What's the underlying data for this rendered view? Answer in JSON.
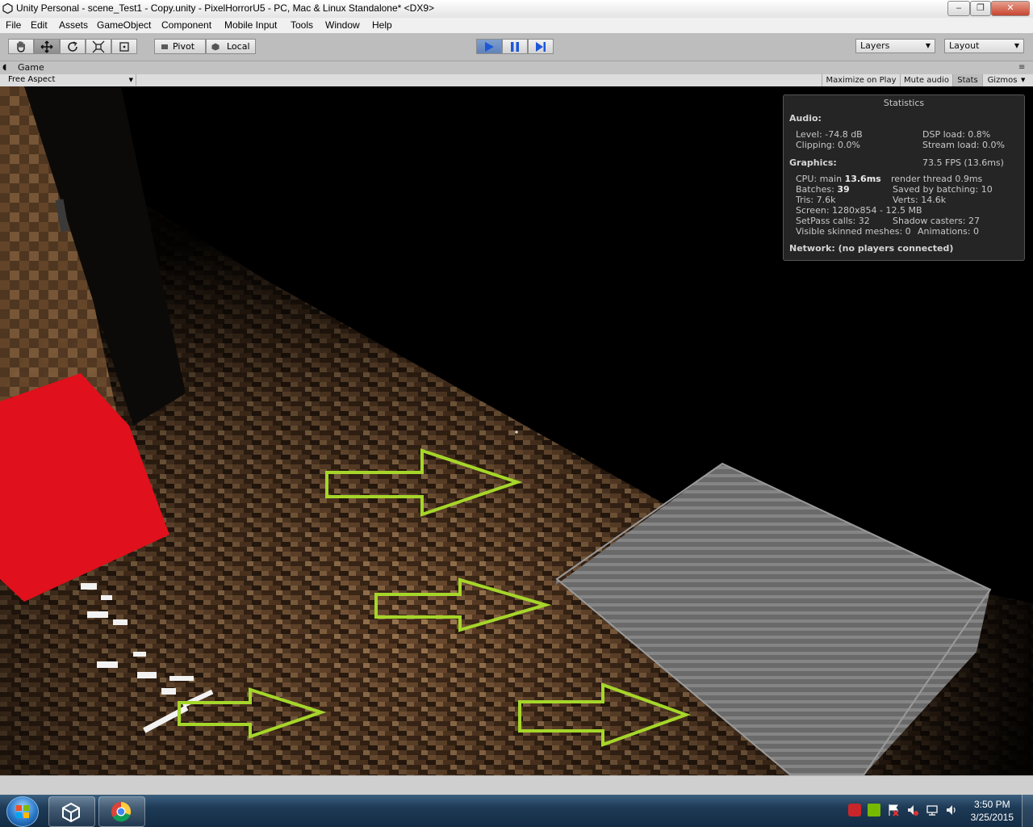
{
  "window": {
    "title": "Unity Personal - scene_Test1 - Copy.unity - PixelHorrorU5 - PC, Mac & Linux Standalone* <DX9>",
    "controls": [
      "‒",
      "❐",
      "✕"
    ]
  },
  "menu": [
    "File",
    "Edit",
    "Assets",
    "GameObject",
    "Component",
    "Mobile Input",
    "Tools",
    "Window",
    "Help"
  ],
  "toolbar": {
    "tools": [
      "hand-tool",
      "move-tool",
      "rotate-tool",
      "scale-tool",
      "rect-tool"
    ],
    "pivot_label": "Pivot",
    "local_label": "Local",
    "playback": [
      "play",
      "pause",
      "step"
    ],
    "layers_label": "Layers",
    "layout_label": "Layout"
  },
  "game_tab": {
    "label": "Game",
    "aspect": "Free Aspect",
    "buttons": [
      "Maximize on Play",
      "Mute audio",
      "Stats",
      "Gizmos"
    ]
  },
  "stats": {
    "title": "Statistics",
    "audio_header": "Audio:",
    "level": "Level: -74.8 dB",
    "dsp_load": "DSP load: 0.8%",
    "clipping": "Clipping: 0.0%",
    "stream_load": "Stream load: 0.0%",
    "graphics_header": "Graphics:",
    "fps": "73.5 FPS (13.6ms)",
    "cpu_prefix": "CPU: main ",
    "cpu_main": "13.6ms",
    "render_thread": "render thread 0.9ms",
    "batches_prefix": "Batches: ",
    "batches": "39",
    "saved_batching": "Saved by batching: 10",
    "tris": "Tris: 7.6k",
    "verts": "Verts: 14.6k",
    "screen": "Screen: 1280x854 - 12.5 MB",
    "setpass": "SetPass calls: 32",
    "shadow_casters": "Shadow casters: 27",
    "skinned": "Visible skinned meshes: 0",
    "animations": "Animations: 0",
    "network": "Network: (no players connected)"
  },
  "taskbar": {
    "time": "3:50 PM",
    "date": "3/25/2015",
    "items": [
      "start-orb",
      "unity-app",
      "chrome-app"
    ]
  },
  "colors": {
    "arrow": "#a6d62a",
    "red_cube": "#e0101c",
    "play_active": "#6a8dc4",
    "floor": "#5a3c24"
  }
}
